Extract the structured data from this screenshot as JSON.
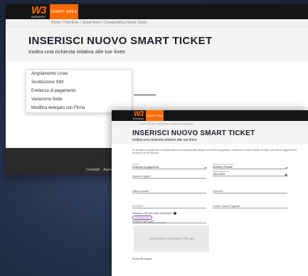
{
  "brand": {
    "logo_text": "W3",
    "logo_sub": "BUSINESS",
    "smart_area_tab": "SMART AREA"
  },
  "back_window": {
    "breadcrumb": [
      "Home",
      "/",
      "Fai da te",
      "/",
      "Smart Area",
      "/",
      "Crea/pubblica Smart Ticket"
    ],
    "title": "INSERISCI NUOVO SMART TICKET",
    "subtitle": "Inoltra una richiesta relativa alle tue linee",
    "dropdown_options": [
      "Ampliamento Linee",
      "Sostituzione SIM",
      "Evidenza di pagamento",
      "Variazione Sede",
      "Modifica delegato con Firma"
    ],
    "footer_links": [
      "Contatti",
      "Agenzie"
    ]
  },
  "front_window": {
    "breadcrumb": [
      "Home",
      "/",
      "Fai da te",
      "/",
      "Smart Area",
      "/",
      "Evidenza di pagamento"
    ],
    "title": "INSERISCI NUOVO SMART TICKET",
    "subtitle": "Inoltra una richiesta relativa alle tue linee",
    "intro": "Se hai fatto un pagamento in modalità diversa da quella prevista, allegaci la ricevuta di pagamento, indicando il Codice Cliente e la data, così potremo aggiornare la situazione del tuo account.",
    "fields": {
      "motivo_label": "Motivo*",
      "motivo_value": "Evidenza di pagamento",
      "metodo_label": "Metodo di pagamento*",
      "metodo_value": "Bollettino Postale",
      "data_label": "Data Pagamento*",
      "data_value": "18/11/2021",
      "importo_label": "",
      "importo_value": "Importo Pagato*",
      "ufficio_label": "",
      "ufficio_value": "Ufficio postale*",
      "sportello_label": "",
      "sportello_value": "Sportello*",
      "vcyv_label": "",
      "vcyv_value": "VCY/VCY",
      "codice_cliente_label": "",
      "codice_cliente_value": "Codice Cliente Pagante*",
      "numero_label": "",
      "numero_value": "Numero Conto per*"
    },
    "select_files_label": "Seleziona i file da inviare (Opzionale)",
    "browse_button": "SFOGLIA FILE",
    "drop_label": "o trascina il file nell'area sottostante",
    "dropzone_text": "Seleziona o trascina i file qui",
    "no_files_text": "Nessun file allegato"
  }
}
